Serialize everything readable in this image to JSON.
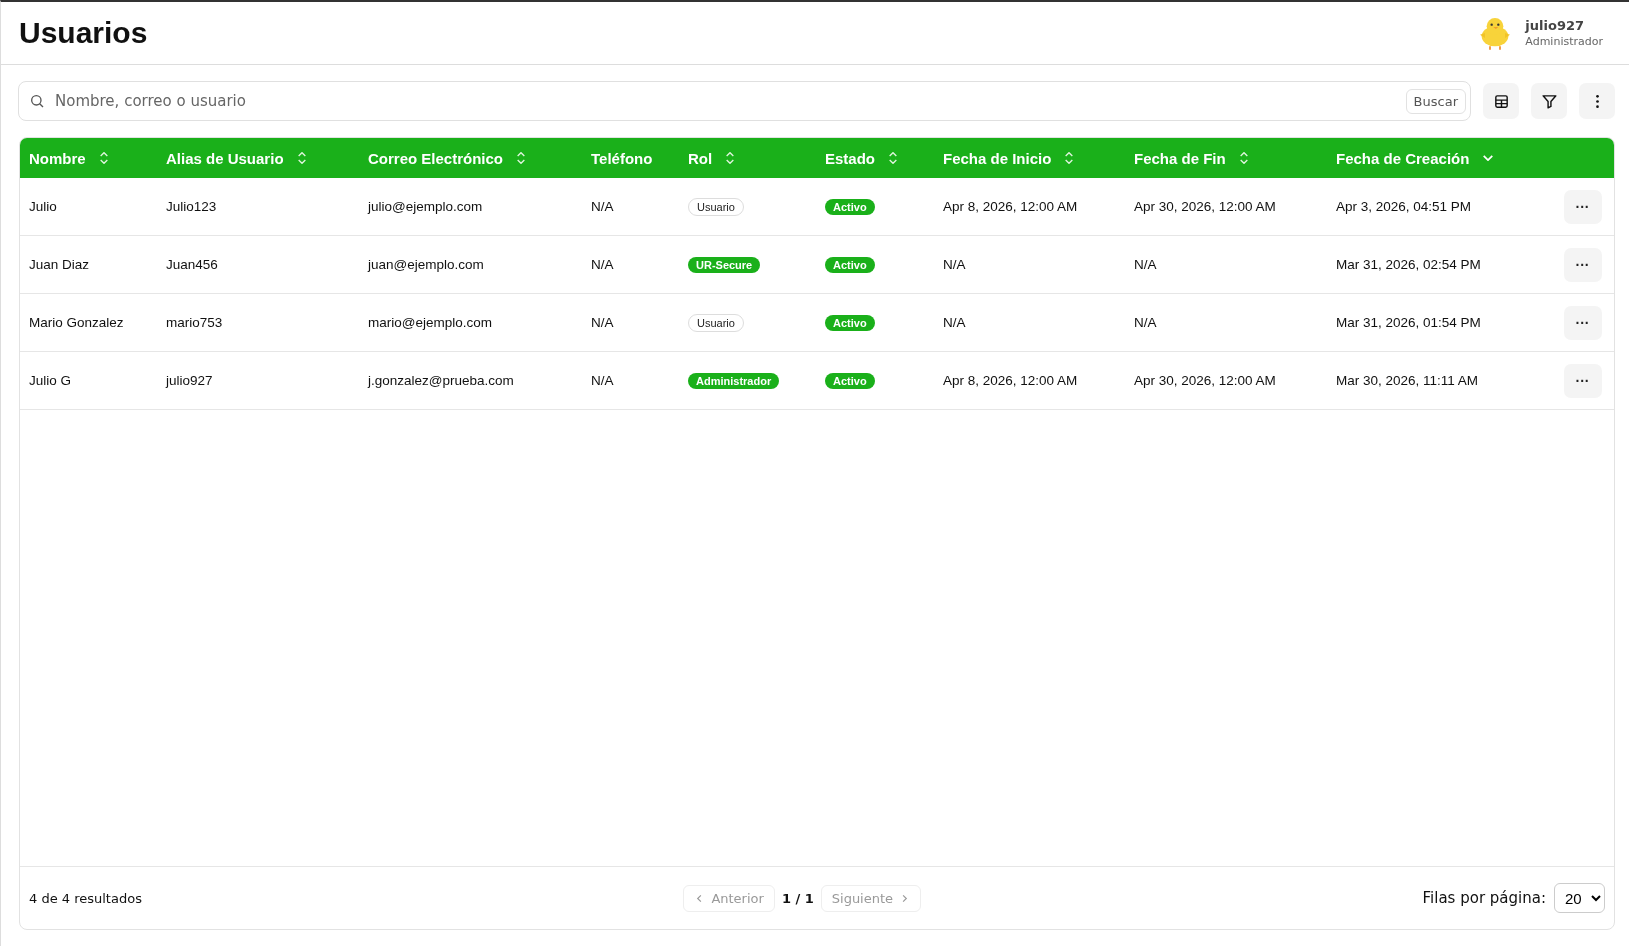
{
  "page_title": "Usuarios",
  "user": {
    "name": "julio927",
    "role": "Administrador"
  },
  "search": {
    "placeholder": "Nombre, correo o usuario",
    "button": "Buscar"
  },
  "toolbar": [
    {
      "kind": "columns"
    },
    {
      "kind": "filter"
    },
    {
      "kind": "more"
    }
  ],
  "table": {
    "columns": [
      {
        "label": "Nombre",
        "sortable": true,
        "sorted": false
      },
      {
        "label": "Alias de Usuario",
        "sortable": true,
        "sorted": false
      },
      {
        "label": "Correo Electrónico",
        "sortable": true,
        "sorted": false
      },
      {
        "label": "Teléfono",
        "sortable": false,
        "sorted": false
      },
      {
        "label": "Rol",
        "sortable": true,
        "sorted": false
      },
      {
        "label": "Estado",
        "sortable": true,
        "sorted": false
      },
      {
        "label": "Fecha de Inicio",
        "sortable": true,
        "sorted": false
      },
      {
        "label": "Fecha de Fin",
        "sortable": true,
        "sorted": false
      },
      {
        "label": "Fecha de Creación",
        "sortable": true,
        "sorted": true
      }
    ],
    "rows": [
      {
        "cells": [
          {
            "text": "Julio"
          },
          {
            "text": "Julio123"
          },
          {
            "text": "julio@ejemplo.com"
          },
          {
            "text": "N/A"
          },
          {
            "text": "Usuario",
            "kind": "outline"
          },
          {
            "text": "Activo",
            "kind": "filled"
          },
          {
            "text": "Apr 8, 2026, 12:00 AM"
          },
          {
            "text": "Apr 30, 2026, 12:00 AM"
          },
          {
            "text": "Apr 3, 2026, 04:51 PM"
          }
        ],
        "actions": "···"
      },
      {
        "cells": [
          {
            "text": "Juan Diaz"
          },
          {
            "text": "Juan456"
          },
          {
            "text": "juan@ejemplo.com"
          },
          {
            "text": "N/A"
          },
          {
            "text": "UR-Secure",
            "kind": "filled"
          },
          {
            "text": "Activo",
            "kind": "filled"
          },
          {
            "text": "N/A"
          },
          {
            "text": "N/A"
          },
          {
            "text": "Mar 31, 2026, 02:54 PM"
          }
        ],
        "actions": "···"
      },
      {
        "cells": [
          {
            "text": "Mario Gonzalez"
          },
          {
            "text": "mario753"
          },
          {
            "text": "mario@ejemplo.com"
          },
          {
            "text": "N/A"
          },
          {
            "text": "Usuario",
            "kind": "outline"
          },
          {
            "text": "Activo",
            "kind": "filled"
          },
          {
            "text": "N/A"
          },
          {
            "text": "N/A"
          },
          {
            "text": "Mar 31, 2026, 01:54 PM"
          }
        ],
        "actions": "···"
      },
      {
        "cells": [
          {
            "text": "Julio G"
          },
          {
            "text": "julio927"
          },
          {
            "text": "j.gonzalez@prueba.com"
          },
          {
            "text": "N/A"
          },
          {
            "text": "Administrador",
            "kind": "filled"
          },
          {
            "text": "Activo",
            "kind": "filled"
          },
          {
            "text": "Apr 8, 2026, 12:00 AM"
          },
          {
            "text": "Apr 30, 2026, 12:00 AM"
          },
          {
            "text": "Mar 30, 2026, 11:11 AM"
          }
        ],
        "actions": "···"
      }
    ]
  },
  "footer": {
    "summary": "4 de 4 resultados",
    "prev": {
      "label": "Anterior",
      "disabled": true
    },
    "page": "1 / 1",
    "next": {
      "label": "Siguiente",
      "disabled": true
    },
    "rows_label": "Filas por página:",
    "rows_value": "20"
  }
}
